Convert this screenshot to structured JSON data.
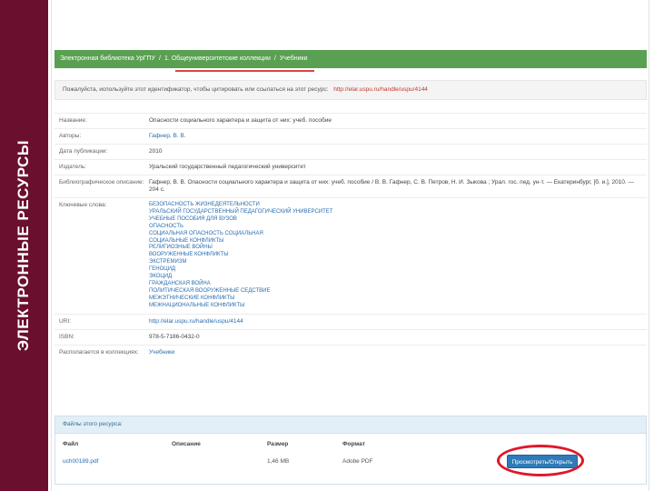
{
  "sidebar": {
    "title": "ЭЛЕКТРОННЫЕ   РЕСУРСЫ"
  },
  "breadcrumb": {
    "items": [
      "Электронная библиотека УрГПУ",
      "1. Общеуниверситетские коллекции",
      "Учебники"
    ],
    "separator": "/"
  },
  "notice": {
    "text": "Пожалуйста, используйте этот идентификатор, чтобы цитировать или ссылаться на этот ресурс:",
    "link": "http://elar.uspu.ru/handle/uspu/4144"
  },
  "record": {
    "rows": [
      {
        "label": "Название:",
        "value": "Опасности социального характера и защита от них: учеб. пособие",
        "is_link": false
      },
      {
        "label": "Авторы:",
        "value": "Гафнер, В. В.",
        "is_link": true
      },
      {
        "label": "Дата публикации:",
        "value": "2010",
        "is_link": false
      },
      {
        "label": "Издатель:",
        "value": "Уральский государственный педагогический университет",
        "is_link": false
      },
      {
        "label": "Библиографическое описание:",
        "value": "Гафнер, В. В. Опасности социального характера и защита от них: учеб. пособие / В. В. Гафнер, С. В. Петров, Н. И. Зыкова ; Урал. гос. пед. ун-т. — Екатеринбург, [б. и.], 2010. — 204 с.",
        "is_link": false
      }
    ],
    "keywords_label": "Ключевые слова:",
    "keywords": [
      "БЕЗОПАСНОСТЬ ЖИЗНЕДЕЯТЕЛЬНОСТИ",
      "УРАЛЬСКИЙ ГОСУДАРСТВЕННЫЙ ПЕДАГОГИЧЕСКИЙ УНИВЕРСИТЕТ",
      "УЧЕБНЫЕ ПОСОБИЯ ДЛЯ ВУЗОВ",
      "ОПАСНОСТЬ",
      "СОЦИАЛЬНАЯ ОПАСНОСТЬ СОЦИАЛЬНАЯ",
      "СОЦИАЛЬНЫЕ КОНФЛИКТЫ",
      "РЕЛИГИОЗНЫЕ ВОЙНЫ",
      "ВООРУЖЕННЫЕ КОНФЛИКТЫ",
      "ЭКСТРЕМИЗМ",
      "ГЕНОЦИД",
      "ЭКОЦИД",
      "ГРАЖДАНСКАЯ ВОЙНА",
      "ПОЛИТИЧЕСКАЯ ВООРУЖЕННЫЕ СЕДСТВИЕ",
      "МЕЖЭТНИЧЕСКИЕ КОНФЛИКТЫ",
      "МЕЖНАЦИОНАЛЬНЫЕ КОНФЛИКТЫ"
    ],
    "uri_label": "URI:",
    "uri": "http://elar.uspu.ru/handle/uspu/4144",
    "isbn_label": "ISBN:",
    "isbn": "978-5-7186-0432-0",
    "collection_label": "Располагается в коллекциях:",
    "collection": "Учебники"
  },
  "files": {
    "heading": "Файлы этого ресурса:",
    "columns": {
      "file": "Файл",
      "description": "Описание",
      "size": "Размер",
      "format": "Формат"
    },
    "rows": [
      {
        "file": "uch00189.pdf",
        "description": "",
        "size": "1,46 MB",
        "format": "Adobe PDF",
        "button": "Просмотреть/Открыть"
      }
    ]
  },
  "colors": {
    "sidebar": "#6b0f2e",
    "breadcrumb_bg": "#5aa052",
    "highlight": "#e0172a",
    "button": "#2f7ab8"
  }
}
